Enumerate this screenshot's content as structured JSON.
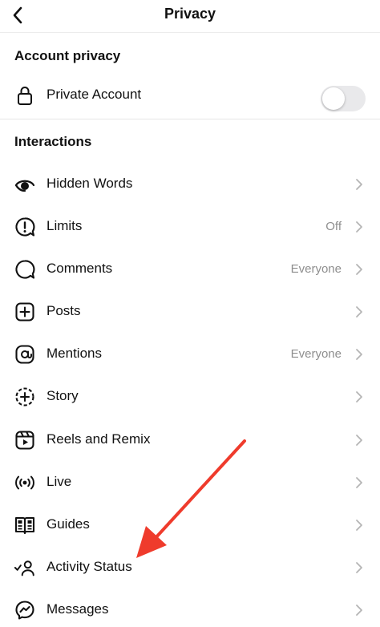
{
  "header": {
    "title": "Privacy",
    "back_icon": "chevron-left-icon"
  },
  "account_privacy": {
    "section_title": "Account privacy",
    "private_account": {
      "label": "Private Account",
      "icon": "lock-icon",
      "enabled": false
    }
  },
  "interactions": {
    "section_title": "Interactions",
    "items": [
      {
        "label": "Hidden Words",
        "value": "",
        "icon": "eye-off-icon"
      },
      {
        "label": "Limits",
        "value": "Off",
        "icon": "alert-bubble-icon"
      },
      {
        "label": "Comments",
        "value": "Everyone",
        "icon": "comment-bubble-icon"
      },
      {
        "label": "Posts",
        "value": "",
        "icon": "plus-square-icon"
      },
      {
        "label": "Mentions",
        "value": "Everyone",
        "icon": "at-sign-icon"
      },
      {
        "label": "Story",
        "value": "",
        "icon": "story-plus-icon"
      },
      {
        "label": "Reels and Remix",
        "value": "",
        "icon": "reels-icon"
      },
      {
        "label": "Live",
        "value": "",
        "icon": "live-broadcast-icon"
      },
      {
        "label": "Guides",
        "value": "",
        "icon": "guide-book-icon"
      },
      {
        "label": "Activity Status",
        "value": "",
        "icon": "activity-status-icon"
      },
      {
        "label": "Messages",
        "value": "",
        "icon": "messenger-icon"
      }
    ]
  },
  "colors": {
    "text": "#111111",
    "secondary_text": "#8e8e8e",
    "toggle_off": "#e9e9eb",
    "annotation_arrow": "#ef3b2c"
  }
}
